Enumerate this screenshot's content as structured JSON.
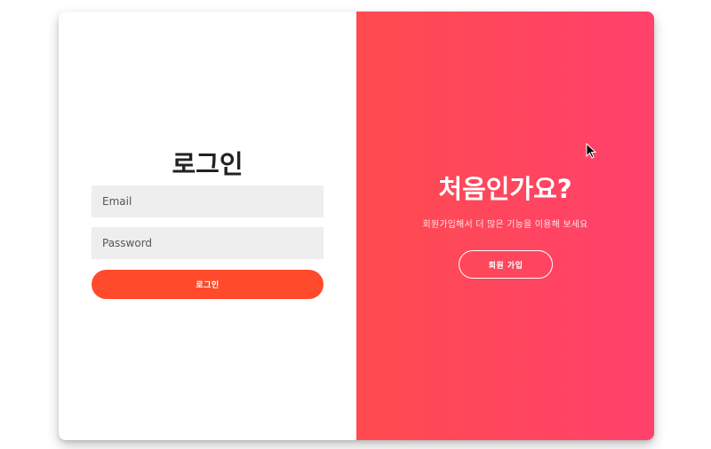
{
  "login": {
    "title": "로그인",
    "email_placeholder": "Email",
    "password_placeholder": "Password",
    "button_label": "로그인"
  },
  "signup": {
    "title": "처음인가요?",
    "description": "회원가입해서 더 많은 기능을 이용해 보세요",
    "button_label": "회원 가입"
  },
  "colors": {
    "accent": "#ff4b2b",
    "panel_gradient_start": "#ff4b4f",
    "panel_gradient_end": "#ff416c",
    "input_background": "#eeeeee"
  },
  "icons": {
    "cursor": "mouse-pointer-icon"
  }
}
